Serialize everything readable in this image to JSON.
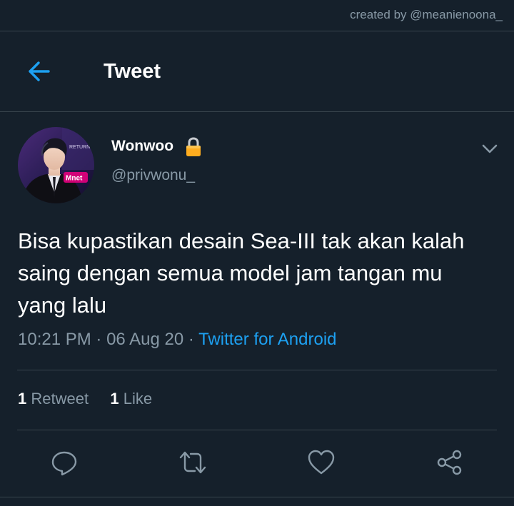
{
  "watermark": "created by @meanienoona_",
  "header": {
    "title": "Tweet",
    "back_icon": "arrow-left-icon"
  },
  "author": {
    "display_name": "Wonwoo",
    "handle": "@privwonu_",
    "protected_icon": "lock-icon",
    "avatar_badge": "Mnet",
    "avatar_caption": "RETURN"
  },
  "tweet": {
    "text": "Bisa kupastikan desain Sea-III tak akan kalah saing dengan semua model jam tangan mu yang lalu",
    "time": "10:21 PM",
    "separator": "·",
    "date": "06 Aug 20",
    "source": "Twitter for Android"
  },
  "stats": {
    "retweets_count": "1",
    "retweets_label": "Retweet",
    "likes_count": "1",
    "likes_label": "Like"
  },
  "actions": {
    "reply_icon": "reply-icon",
    "retweet_icon": "retweet-icon",
    "like_icon": "heart-icon",
    "share_icon": "share-icon"
  },
  "colors": {
    "background": "#15202b",
    "accent": "#1da1f2",
    "secondary_text": "#8899a6",
    "divider": "#38444d",
    "lock": "#ffad1f"
  }
}
